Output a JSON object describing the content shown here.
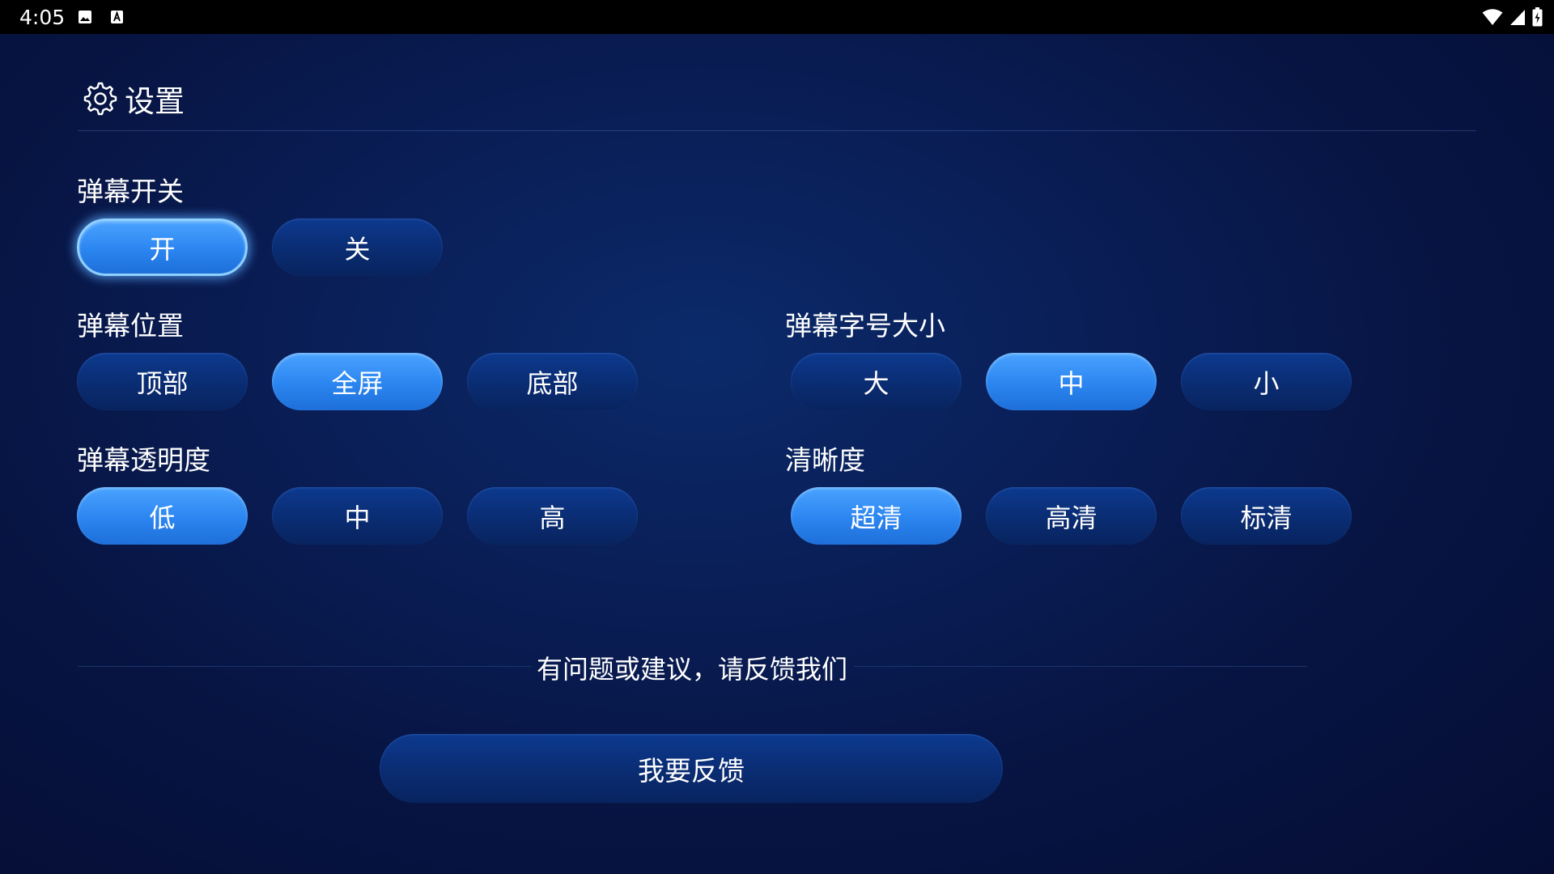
{
  "status_bar": {
    "time": "4:05"
  },
  "header": {
    "icon": "gear-icon",
    "title": "设置"
  },
  "danmaku_switch": {
    "label": "弹幕开关",
    "options": [
      "开",
      "关"
    ],
    "selected": "开"
  },
  "danmaku_position": {
    "label": "弹幕位置",
    "options": [
      "顶部",
      "全屏",
      "底部"
    ],
    "selected": "全屏"
  },
  "danmaku_font_size": {
    "label": "弹幕字号大小",
    "options": [
      "大",
      "中",
      "小"
    ],
    "selected": "中"
  },
  "danmaku_opacity": {
    "label": "弹幕透明度",
    "options": [
      "低",
      "中",
      "高"
    ],
    "selected": "低"
  },
  "clarity": {
    "label": "清晰度",
    "options": [
      "超清",
      "高清",
      "标清"
    ],
    "selected": "超清"
  },
  "feedback": {
    "prompt": "有问题或建议，请反馈我们",
    "button_label": "我要反馈"
  },
  "colors": {
    "selected_button": "#2b85f0",
    "unselected_button": "#0a2c72",
    "background": "#071544",
    "focus_glow": "#8fd0ff"
  }
}
